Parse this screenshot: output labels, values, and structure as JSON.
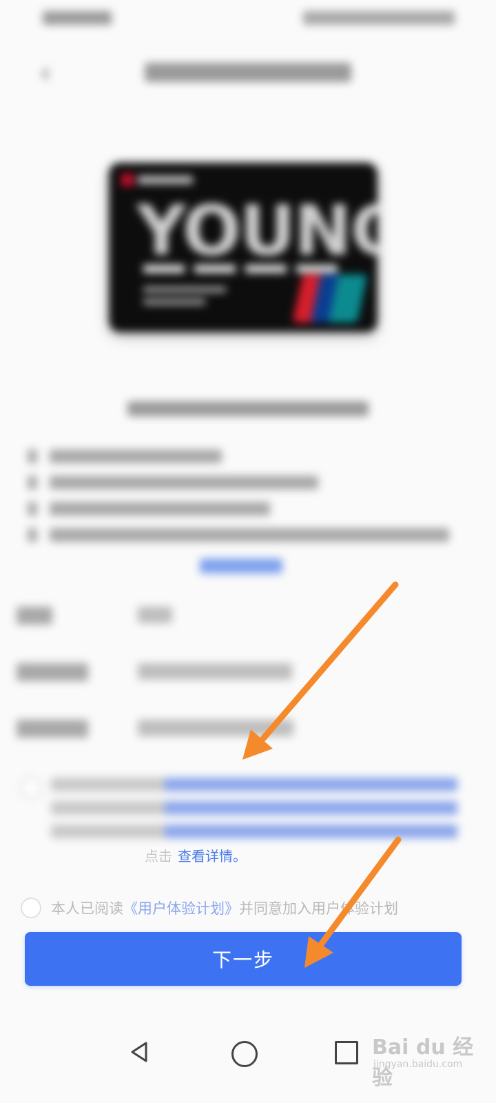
{
  "header": {
    "back_icon": "chevron-left-icon"
  },
  "card": {
    "brand_text": "YOUNG",
    "network_icon": "unionpay-logo"
  },
  "agreement": {
    "tail_prefix": "点击",
    "view_details_link": "查看详情。"
  },
  "ux_plan": {
    "prefix": "本人已阅读",
    "link": "《用户体验计划》",
    "suffix": "并同意加入用户体验计划"
  },
  "next_button": {
    "label": "下一步"
  },
  "nav_bar": {
    "back_icon": "triangle-back-icon",
    "home_icon": "circle-home-icon",
    "recent_icon": "square-recent-icon"
  },
  "watermark": {
    "main": "Bai du 经验",
    "sub": "jingyan.baidu.com"
  },
  "colors": {
    "primary": "#3d73f2",
    "link": "#4a7be6",
    "annotation_arrow": "#f58a2c"
  }
}
